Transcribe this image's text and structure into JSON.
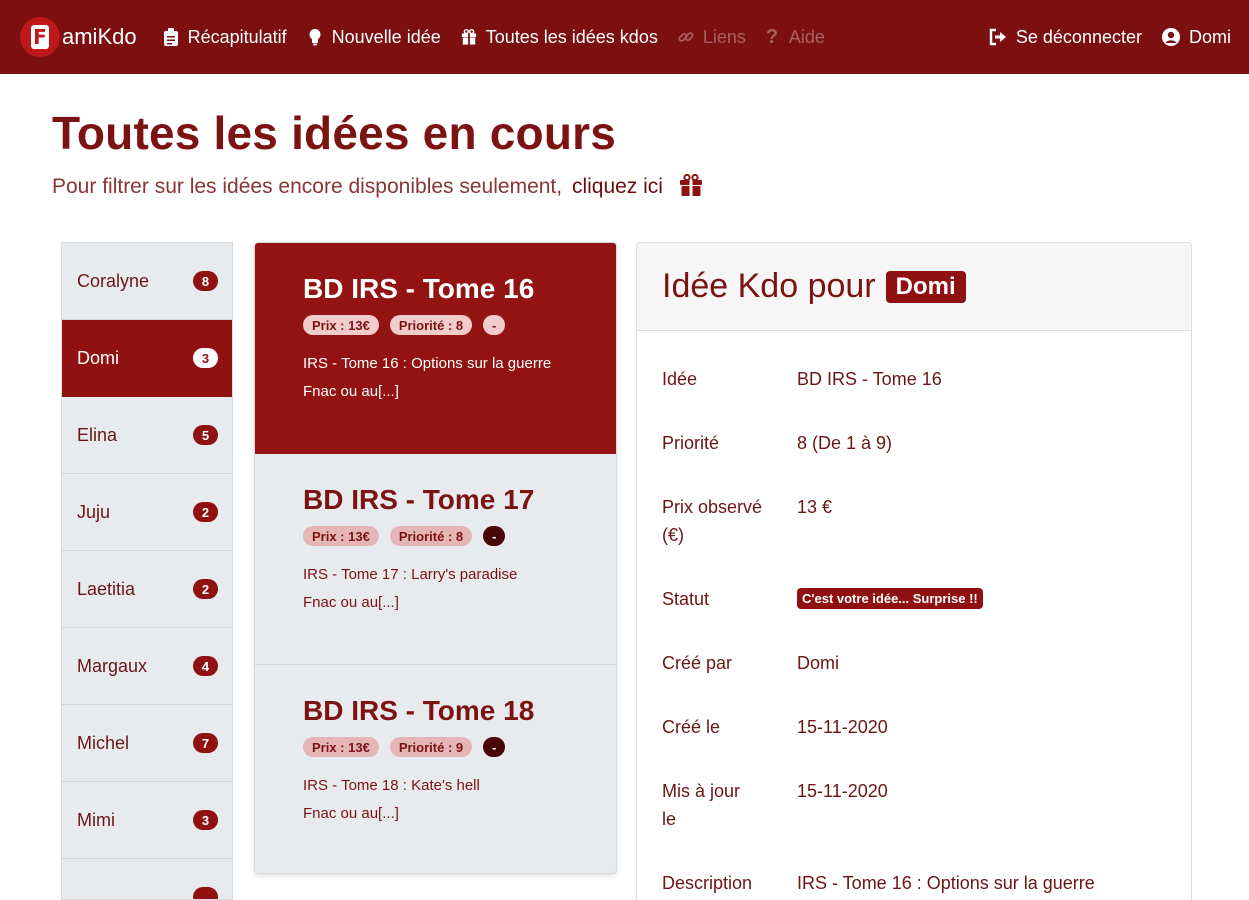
{
  "nav": {
    "brand": "amiKdo",
    "items": [
      {
        "label": "Récapitulatif",
        "icon": "clipboard-icon",
        "disabled": false
      },
      {
        "label": "Nouvelle idée",
        "icon": "lightbulb-icon",
        "disabled": false
      },
      {
        "label": "Toutes les idées kdos",
        "icon": "gift-icon",
        "disabled": false
      },
      {
        "label": "Liens",
        "icon": "link-icon",
        "disabled": true
      },
      {
        "label": "Aide",
        "icon": "question-icon",
        "disabled": true
      }
    ],
    "logout": "Se déconnecter",
    "user": "Domi"
  },
  "header": {
    "title": "Toutes les idées en cours",
    "subtitle": "Pour filtrer sur les idées encore disponibles seulement,",
    "link": "cliquez ici"
  },
  "people": [
    {
      "name": "Coralyne",
      "count": "8"
    },
    {
      "name": "Domi",
      "count": "3",
      "active": true
    },
    {
      "name": "Elina",
      "count": "5"
    },
    {
      "name": "Juju",
      "count": "2"
    },
    {
      "name": "Laetitia",
      "count": "2"
    },
    {
      "name": "Margaux",
      "count": "4"
    },
    {
      "name": "Michel",
      "count": "7"
    },
    {
      "name": "Mimi",
      "count": "3"
    },
    {
      "name": "",
      "count": ""
    }
  ],
  "ideas": [
    {
      "title": "BD IRS - Tome 16",
      "price": "Prix : 13€",
      "priority": "Priorité : 8",
      "dash": "-",
      "desc1": "IRS - Tome 16 : Options sur la guerre",
      "desc2": "Fnac ou au[...]"
    },
    {
      "title": "BD IRS - Tome 17",
      "price": "Prix : 13€",
      "priority": "Priorité : 8",
      "dash": "-",
      "desc1": "IRS - Tome 17 : Larry's paradise",
      "desc2": "Fnac ou au[...]"
    },
    {
      "title": "BD IRS - Tome 18",
      "price": "Prix : 13€",
      "priority": "Priorité : 9",
      "dash": "-",
      "desc1": "IRS - Tome 18 : Kate's hell",
      "desc2": "Fnac ou au[...]"
    }
  ],
  "detail": {
    "title": "Idée Kdo pour",
    "who": "Domi",
    "rows": [
      {
        "label": "Idée",
        "value": "BD IRS - Tome 16"
      },
      {
        "label": "Priorité",
        "value": "8 (De 1 à 9)"
      },
      {
        "label": "Prix observé (€)",
        "value": "13 €"
      },
      {
        "label": "Statut",
        "value": "C'est votre idée... Surprise !!"
      },
      {
        "label": "Créé par",
        "value": "Domi"
      },
      {
        "label": "Créé le",
        "value": "15-11-2020"
      },
      {
        "label": "Mis à jour le",
        "value": "15-11-2020"
      },
      {
        "label": "Description",
        "value": "IRS - Tome 16 : Options sur la guerre"
      }
    ]
  },
  "colors": {
    "navbar": "#7c1010",
    "accent": "#8f1111",
    "panel": "#e8ebee"
  }
}
